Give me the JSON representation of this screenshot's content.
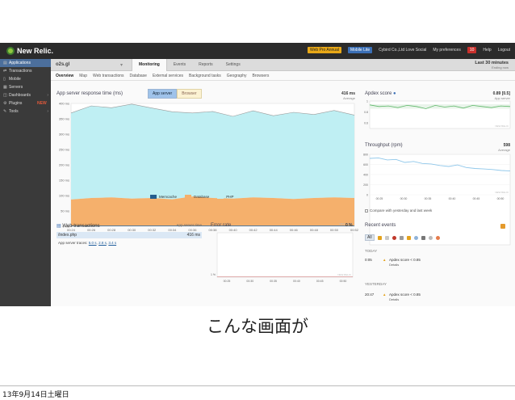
{
  "topbar": {
    "brand": "New Relic.",
    "plan_badge": "Web Pro Annual",
    "mobile_badge": "Mobile Lite",
    "account": "Cybird Co.,Ltd Love Social",
    "preferences": "My preferences",
    "notifications_count": "10",
    "help": "Help",
    "logout": "Logout"
  },
  "sidebar": {
    "items": [
      {
        "label": "Applications",
        "icon": "applications-icon"
      },
      {
        "label": "Transactions",
        "icon": "transactions-icon"
      },
      {
        "label": "Mobile",
        "icon": "mobile-icon"
      },
      {
        "label": "Servers",
        "icon": "servers-icon"
      },
      {
        "label": "Dashboards",
        "icon": "dashboards-icon"
      },
      {
        "label": "Plugins",
        "icon": "plugins-icon",
        "badge": "NEW"
      },
      {
        "label": "Tools",
        "icon": "tools-icon"
      }
    ]
  },
  "appbar": {
    "app_name": "o2s.gl",
    "tabs": [
      "Monitoring",
      "Events",
      "Reports",
      "Settings"
    ],
    "time_window": "Last 30 minutes",
    "time_sub": "Ending now"
  },
  "subnav": [
    "Overview",
    "Map",
    "Web transactions",
    "Database",
    "External services",
    "Background tasks",
    "Geography",
    "Browsers"
  ],
  "response_time": {
    "title": "App server response time (ms)",
    "toggle_on": "App server",
    "toggle_off": "Browser",
    "average_value": "416 ms",
    "average_label": "Average",
    "legend": [
      "Memcache",
      "Database",
      "PHP"
    ],
    "watermark": "NEW RELIC"
  },
  "apdex": {
    "title": "Apdex score",
    "value": "0.89 [0.5]",
    "value_label": "App server",
    "watermark": "NEW RELIC"
  },
  "throughput": {
    "title": "Throughput (rpm)",
    "value": "598",
    "value_label": "Average",
    "compare_label": "Compare with yesterday and last week",
    "watermark": "NEW RELIC"
  },
  "web_transactions": {
    "title": "Web transactions",
    "column": "App server time",
    "rows": [
      {
        "name": "/index.php",
        "value": "416 ms"
      }
    ],
    "traces_label": "App server traces:",
    "traces": [
      "5.0 s",
      "2.8 s",
      "3.4 s"
    ]
  },
  "error_rate": {
    "title": "Error rate",
    "value": "0 %",
    "watermark": "NEW RELIC"
  },
  "recent_events": {
    "title": "Recent events",
    "filter_all": "All",
    "today_label": "TODAY",
    "yesterday_label": "YESTERDAY",
    "events": [
      {
        "time": "0:05",
        "message": "Apdex score < 0.85",
        "details": "Details"
      },
      {
        "time": "20:47",
        "message": "Apdex score < 0.85",
        "details": "Details"
      }
    ]
  },
  "slide": {
    "caption": "こんな画面が",
    "date": "13年9月14日土曜日"
  },
  "colors": {
    "memcache": "#245d8e",
    "database": "#f5b06c",
    "php": "#bfeff3",
    "apdex_line": "#5fb86a",
    "throughput_line": "#8fc7ea"
  },
  "chart_data": [
    {
      "type": "area",
      "title": "App server response time (ms)",
      "x": [
        "00:24",
        "00:26",
        "00:28",
        "00:30",
        "00:32",
        "00:34",
        "00:36",
        "00:38",
        "00:40",
        "00:42",
        "00:44",
        "00:46",
        "00:48",
        "00:50",
        "00:52"
      ],
      "ylim": [
        0,
        400
      ],
      "yticks": [
        "0 ms",
        "50 ms",
        "100 ms",
        "150 ms",
        "200 ms",
        "250 ms",
        "300 ms",
        "350 ms",
        "400 ms"
      ],
      "series": [
        {
          "name": "Memcache",
          "values": [
            2,
            2,
            2,
            2,
            2,
            2,
            2,
            2,
            2,
            2,
            2,
            2,
            2,
            2,
            2
          ]
        },
        {
          "name": "Database",
          "values": [
            85,
            90,
            92,
            88,
            90,
            86,
            95,
            90,
            88,
            92,
            90,
            87,
            90,
            92,
            90
          ]
        },
        {
          "name": "PHP",
          "values": [
            282,
            300,
            292,
            308,
            293,
            285,
            272,
            282,
            268,
            282,
            268,
            282,
            272,
            283,
            270
          ]
        }
      ]
    },
    {
      "type": "line",
      "title": "Apdex score",
      "ylim": [
        0.5,
        1
      ],
      "yticks": [
        "1",
        "0.8",
        "0.6"
      ],
      "series": [
        {
          "name": "App server",
          "values": [
            0.93,
            0.9,
            0.91,
            0.88,
            0.92,
            0.9,
            0.86,
            0.92,
            0.89,
            0.91,
            0.87,
            0.92,
            0.9,
            0.88,
            0.91,
            0.9
          ]
        }
      ]
    },
    {
      "type": "line",
      "title": "Throughput (rpm)",
      "x": [
        "00:25",
        "00:30",
        "00:35",
        "00:40",
        "00:45",
        "00:50"
      ],
      "ylim": [
        0,
        800
      ],
      "yticks": [
        "800",
        "600",
        "400",
        "200",
        "0"
      ],
      "series": [
        {
          "name": "Throughput",
          "values": [
            720,
            730,
            690,
            700,
            640,
            660,
            620,
            610,
            580,
            560,
            590,
            540,
            520,
            510,
            500,
            480,
            470
          ]
        }
      ]
    },
    {
      "type": "line",
      "title": "Error rate",
      "x": [
        "00:25",
        "00:30",
        "00:35",
        "00:40",
        "00:45",
        "00:50"
      ],
      "yticks": [
        "1 %"
      ],
      "series": [
        {
          "values": [
            0,
            0,
            0,
            0,
            0,
            0,
            0,
            0,
            0,
            0,
            0
          ]
        }
      ]
    }
  ]
}
